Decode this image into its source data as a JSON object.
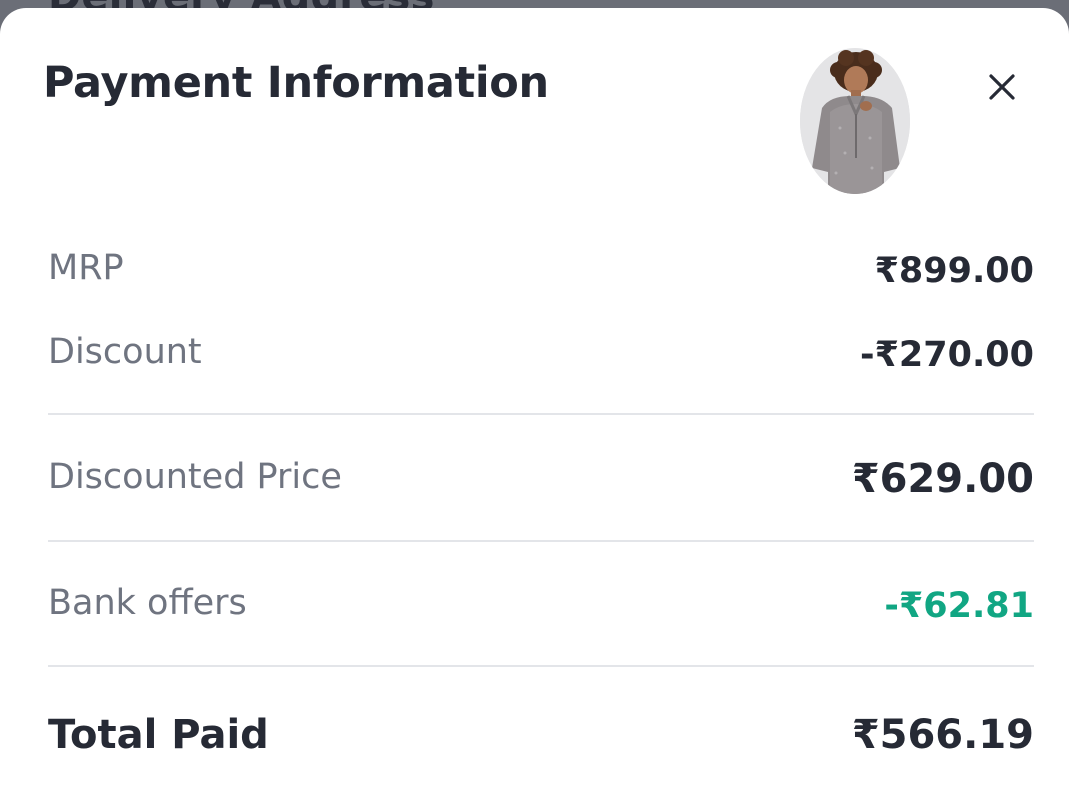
{
  "backdrop": {
    "title": "Delivery Address"
  },
  "sheet": {
    "title": "Payment Information",
    "product_thumbnail_icon": "person-sweater-photo",
    "close_icon": "close-icon"
  },
  "summary": {
    "mrp": {
      "label": "MRP",
      "value": "₹899.00"
    },
    "discount": {
      "label": "Discount",
      "value": "-₹270.00"
    },
    "discounted_price": {
      "label": "Discounted Price",
      "value": "₹629.00"
    },
    "bank_offers": {
      "label": "Bank offers",
      "value": "-₹62.81"
    },
    "total_paid": {
      "label": "Total Paid",
      "value": "₹566.19"
    }
  },
  "colors": {
    "backdrop": "#6b6e77",
    "text_dark": "#262a35",
    "text_muted": "#6f7480",
    "offer_green": "#11a683",
    "divider": "#e3e5e9"
  }
}
